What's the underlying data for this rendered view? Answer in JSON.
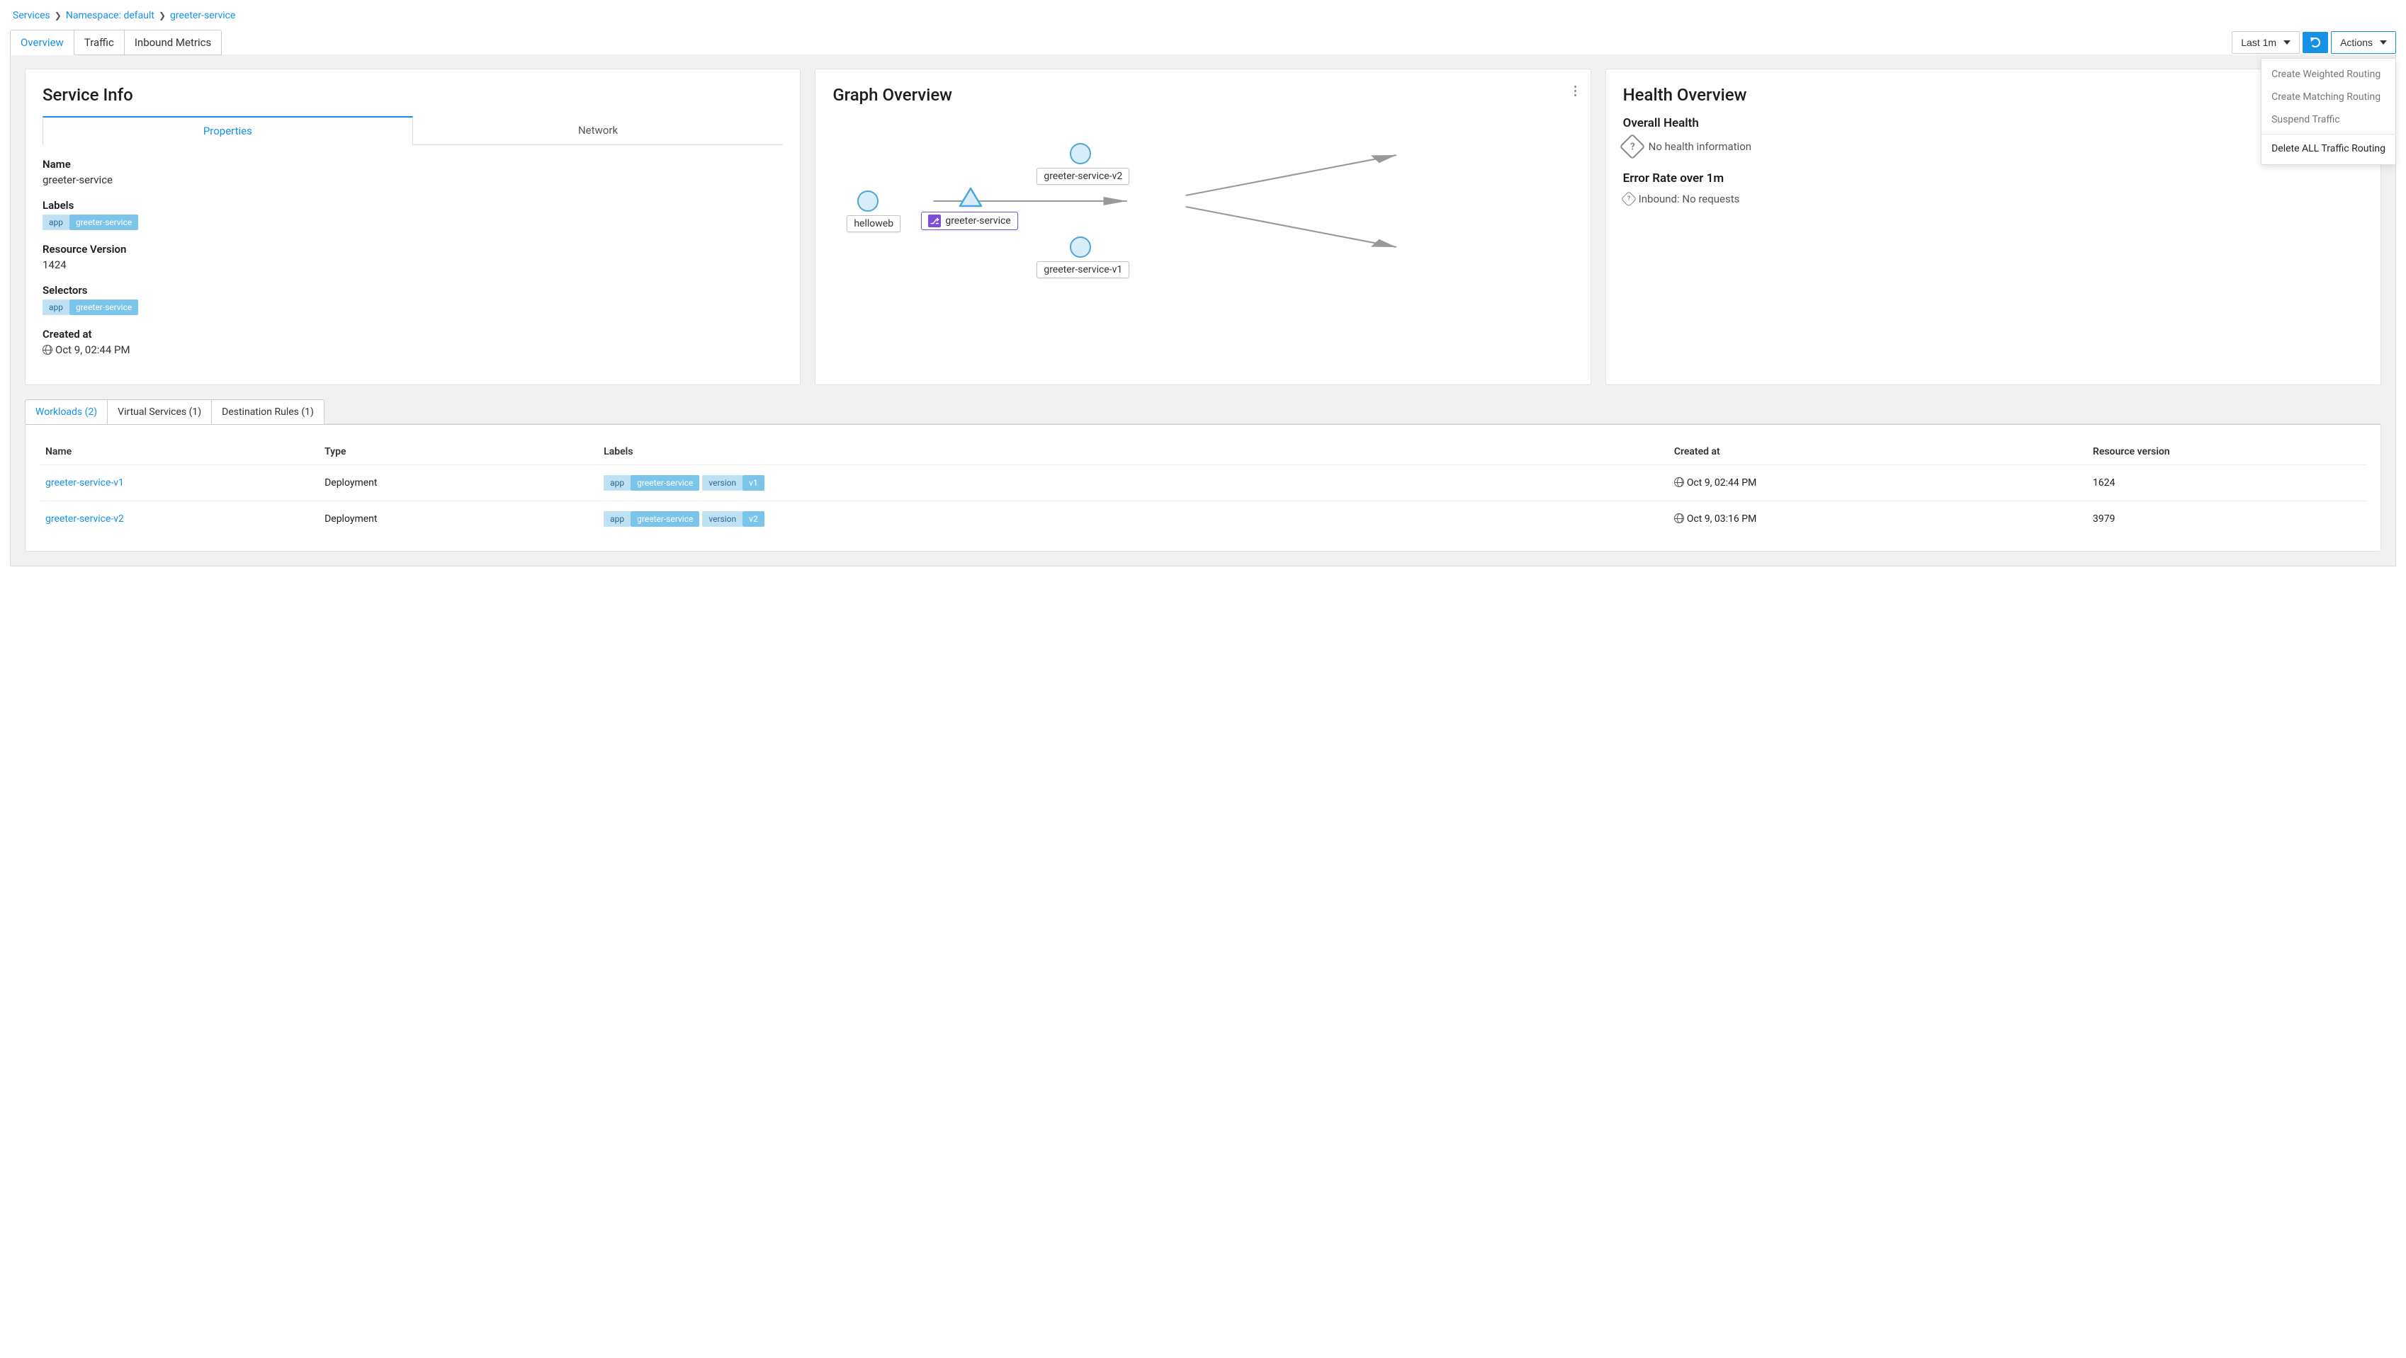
{
  "breadcrumb": {
    "services": "Services",
    "namespace": "Namespace: default",
    "service": "greeter-service"
  },
  "tabs": {
    "overview": "Overview",
    "traffic": "Traffic",
    "inbound": "Inbound Metrics"
  },
  "toolbar": {
    "timerange": "Last 1m",
    "actions": "Actions"
  },
  "actions_menu": {
    "weighted": "Create Weighted Routing",
    "matching": "Create Matching Routing",
    "suspend": "Suspend Traffic",
    "delete": "Delete ALL Traffic Routing"
  },
  "service_info": {
    "title": "Service Info",
    "tab_properties": "Properties",
    "tab_network": "Network",
    "name_label": "Name",
    "name_value": "greeter-service",
    "labels_label": "Labels",
    "labels": [
      {
        "k": "app",
        "v": "greeter-service"
      }
    ],
    "rv_label": "Resource Version",
    "rv_value": "1424",
    "selectors_label": "Selectors",
    "selectors": [
      {
        "k": "app",
        "v": "greeter-service"
      }
    ],
    "created_label": "Created at",
    "created_value": "Oct 9, 02:44 PM"
  },
  "graph": {
    "title": "Graph Overview",
    "nodes": {
      "left": "helloweb",
      "center": "greeter-service",
      "top": "greeter-service-v2",
      "bottom": "greeter-service-v1"
    }
  },
  "health": {
    "title": "Health Overview",
    "overall_label": "Overall Health",
    "overall_value": "No health information",
    "error_label": "Error Rate over 1m",
    "error_value": "Inbound: No requests"
  },
  "bottom_tabs": {
    "workloads": "Workloads (2)",
    "vs": "Virtual Services (1)",
    "dr": "Destination Rules (1)"
  },
  "table": {
    "headers": {
      "name": "Name",
      "type": "Type",
      "labels": "Labels",
      "created": "Created at",
      "rv": "Resource version"
    },
    "rows": [
      {
        "name": "greeter-service-v1",
        "type": "Deployment",
        "labels": [
          {
            "k": "app",
            "v": "greeter-service"
          },
          {
            "k": "version",
            "v": "v1"
          }
        ],
        "created": "Oct 9, 02:44 PM",
        "rv": "1624"
      },
      {
        "name": "greeter-service-v2",
        "type": "Deployment",
        "labels": [
          {
            "k": "app",
            "v": "greeter-service"
          },
          {
            "k": "version",
            "v": "v2"
          }
        ],
        "created": "Oct 9, 03:16 PM",
        "rv": "3979"
      }
    ]
  }
}
